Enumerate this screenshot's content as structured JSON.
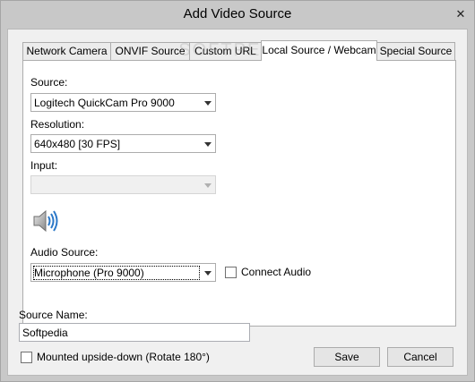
{
  "window": {
    "title": "Add Video Source",
    "close_glyph": "✕"
  },
  "tabs": [
    {
      "label": "Network Camera"
    },
    {
      "label": "ONVIF Source"
    },
    {
      "label": "Custom URL"
    },
    {
      "label": "Local Source / Webcam",
      "active": true
    },
    {
      "label": "Special Source"
    }
  ],
  "watermark": "SOFTPEDIA",
  "form": {
    "source_label": "Source:",
    "source_value": "Logitech QuickCam Pro 9000",
    "resolution_label": "Resolution:",
    "resolution_value": "640x480 [30 FPS]",
    "input_label": "Input:",
    "input_value": "",
    "audio_icon": "speaker-icon",
    "audio_source_label": "Audio Source:",
    "audio_source_value": "Microphone (Pro 9000)",
    "connect_audio_label": "Connect Audio",
    "connect_audio_checked": false
  },
  "bottom": {
    "source_name_label": "Source Name:",
    "source_name_value": "Softpedia",
    "mounted_label": "Mounted upside-down (Rotate 180°)",
    "mounted_checked": false,
    "save_label": "Save",
    "cancel_label": "Cancel"
  }
}
